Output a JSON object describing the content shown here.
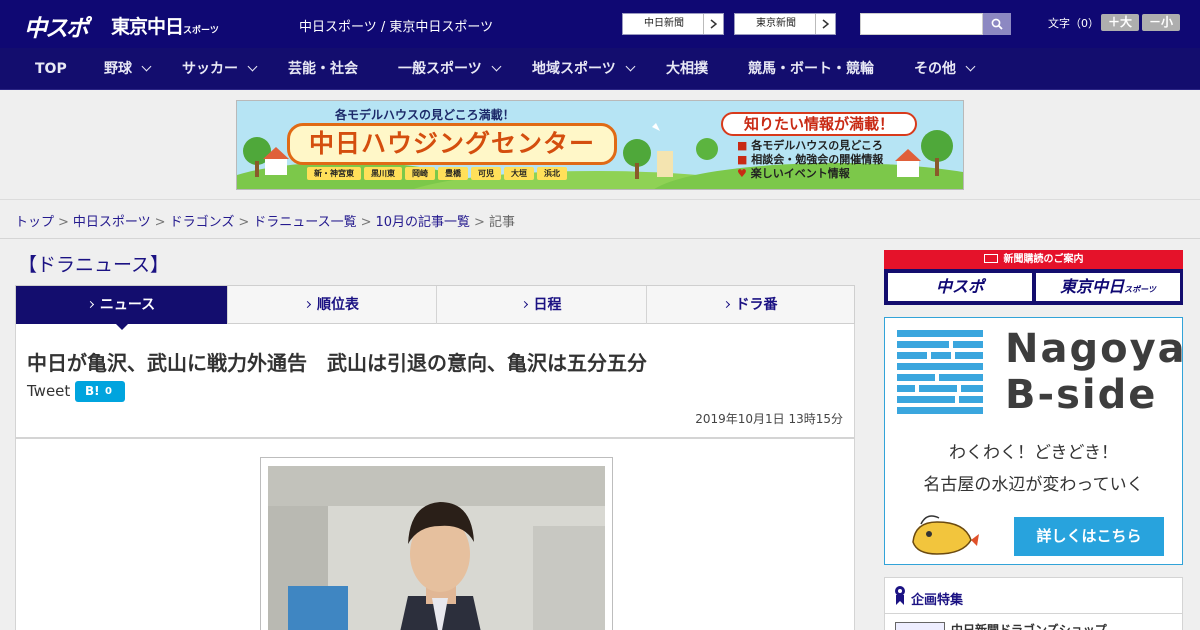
{
  "header": {
    "logo_main": "中スポ",
    "logo_tokyo": "東京中日",
    "logo_tokyo_small": "スポーツ",
    "site_links": "中日スポーツ / 東京中日スポーツ",
    "paper_buttons": [
      {
        "label": "中日新聞"
      },
      {
        "label": "東京新聞"
      }
    ],
    "search": {
      "placeholder": "",
      "value": ""
    },
    "font_size_label": "文字（0）",
    "font_larger": "＋大",
    "font_smaller": "－小"
  },
  "nav": {
    "items": [
      {
        "label": "TOP",
        "dropdown": false
      },
      {
        "label": "野球",
        "dropdown": true
      },
      {
        "label": "サッカー",
        "dropdown": true
      },
      {
        "label": "芸能・社会",
        "dropdown": false
      },
      {
        "label": "一般スポーツ",
        "dropdown": true
      },
      {
        "label": "地域スポーツ",
        "dropdown": true
      },
      {
        "label": "大相撲",
        "dropdown": false
      },
      {
        "label": "競馬・ボート・競輪",
        "dropdown": false
      },
      {
        "label": "その他",
        "dropdown": true
      }
    ]
  },
  "banner": {
    "top_line": "各モデルハウスの見どころ満載！",
    "title": "中日ハウジングセンター",
    "places": [
      "新・神宮東",
      "黒川東",
      "岡崎",
      "豊橋",
      "可児",
      "大垣",
      "浜北"
    ],
    "right_title": "知りたい情報が満載！",
    "list": [
      "各モデルハウスの見どころ",
      "相談会・勉強会の開催情報",
      "楽しいイベント情報"
    ]
  },
  "breadcrumb": {
    "items": [
      "トップ",
      "中日スポーツ",
      "ドラゴンズ",
      "ドラニュース一覧",
      "10月の記事一覧"
    ],
    "current": "記事"
  },
  "main": {
    "section_title": "【ドラニュース】",
    "tabs": [
      {
        "label": "ニュース",
        "active": true
      },
      {
        "label": "順位表",
        "active": false
      },
      {
        "label": "日程",
        "active": false
      },
      {
        "label": "ドラ番",
        "active": false
      }
    ],
    "headline": "中日が亀沢、武山に戦力外通告　武山は引退の意向、亀沢は五分五分",
    "tweet_label": "Tweet",
    "hatena_label": "B!",
    "hatena_count": "0",
    "date": "2019年10月1日 13時15分"
  },
  "sidebar": {
    "subscription": {
      "title": "新聞購読のご案内",
      "left_logo": "中スポ",
      "right_logo": "東京中日",
      "right_logo_small": "スポーツ"
    },
    "ad": {
      "brand_line1": "Nagoya",
      "brand_line2": "B-side",
      "tagline1": "わくわく！どきどき！",
      "tagline2": "名古屋の水辺が変わっていく",
      "cta": "詳しくはこちら"
    },
    "feature": {
      "title": "企画特集",
      "item": "中日新聞ドラゴンズショップ"
    }
  },
  "colors": {
    "header_bg": "#0f0873",
    "nav_bg": "#130d6e",
    "link": "#241a8e",
    "accent_red": "#e5122a",
    "accent_blue": "#28a3dd",
    "hatena_blue": "#00a4de"
  }
}
